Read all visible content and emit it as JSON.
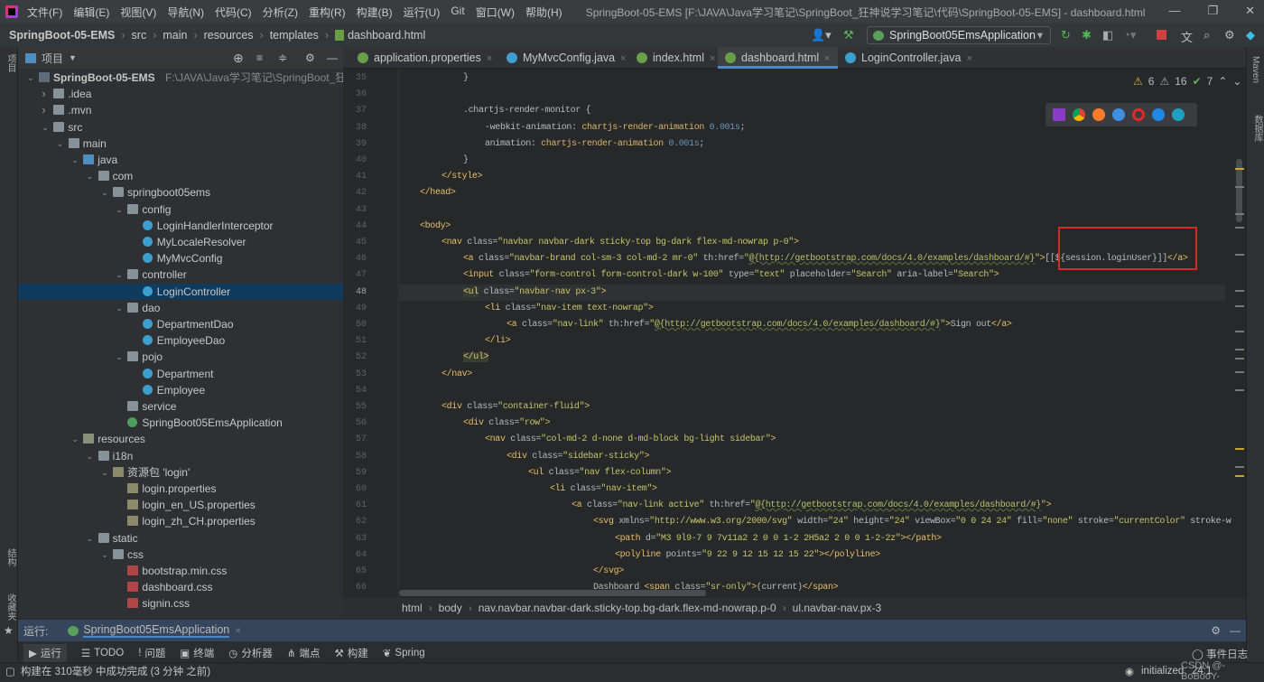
{
  "app": {
    "menu": [
      "文件(F)",
      "编辑(E)",
      "视图(V)",
      "导航(N)",
      "代码(C)",
      "分析(Z)",
      "重构(R)",
      "构建(B)",
      "运行(U)",
      "Git",
      "窗口(W)",
      "帮助(H)"
    ],
    "window_title": "SpringBoot-05-EMS [F:\\JAVA\\Java学习笔记\\SpringBoot_狂神说学习笔记\\代码\\SpringBoot-05-EMS] - dashboard.html",
    "window_buttons": [
      "—",
      "❐",
      "✕"
    ]
  },
  "breadcrumb": [
    "SpringBoot-05-EMS",
    "src",
    "main",
    "resources",
    "templates",
    "dashboard.html"
  ],
  "run_config": "SpringBoot05EmsApplication",
  "project_panel": {
    "title": "项目",
    "side_label": "项目"
  },
  "tree": [
    {
      "d": 0,
      "a": "v",
      "i": "module",
      "t": "SpringBoot-05-EMS",
      "extra": "F:\\JAVA\\Java学习笔记\\SpringBoot_狂神"
    },
    {
      "d": 1,
      "a": ">",
      "i": "folder",
      "t": ".idea"
    },
    {
      "d": 1,
      "a": ">",
      "i": "folder",
      "t": ".mvn"
    },
    {
      "d": 1,
      "a": "v",
      "i": "folder",
      "t": "src"
    },
    {
      "d": 2,
      "a": "v",
      "i": "folder",
      "t": "main"
    },
    {
      "d": 3,
      "a": "v",
      "i": "folder src",
      "t": "java"
    },
    {
      "d": 4,
      "a": "v",
      "i": "folder",
      "t": "com"
    },
    {
      "d": 5,
      "a": "v",
      "i": "folder",
      "t": "springboot05ems"
    },
    {
      "d": 6,
      "a": "v",
      "i": "folder",
      "t": "config"
    },
    {
      "d": 7,
      "a": "",
      "i": "cls",
      "t": "LoginHandlerInterceptor"
    },
    {
      "d": 7,
      "a": "",
      "i": "cls",
      "t": "MyLocaleResolver"
    },
    {
      "d": 7,
      "a": "",
      "i": "cls",
      "t": "MyMvcConfig"
    },
    {
      "d": 6,
      "a": "v",
      "i": "folder",
      "t": "controller"
    },
    {
      "d": 7,
      "a": "",
      "i": "cls",
      "t": "LoginController",
      "sel": true
    },
    {
      "d": 6,
      "a": "v",
      "i": "folder",
      "t": "dao"
    },
    {
      "d": 7,
      "a": "",
      "i": "cls",
      "t": "DepartmentDao"
    },
    {
      "d": 7,
      "a": "",
      "i": "cls",
      "t": "EmployeeDao"
    },
    {
      "d": 6,
      "a": "v",
      "i": "folder",
      "t": "pojo"
    },
    {
      "d": 7,
      "a": "",
      "i": "cls",
      "t": "Department"
    },
    {
      "d": 7,
      "a": "",
      "i": "cls",
      "t": "Employee"
    },
    {
      "d": 6,
      "a": "",
      "i": "folder",
      "t": "service"
    },
    {
      "d": 6,
      "a": "",
      "i": "boot",
      "t": "SpringBoot05EmsApplication"
    },
    {
      "d": 3,
      "a": "v",
      "i": "folder res",
      "t": "resources"
    },
    {
      "d": 4,
      "a": "v",
      "i": "folder",
      "t": "i18n"
    },
    {
      "d": 5,
      "a": "v",
      "i": "prop",
      "t": "资源包 'login'"
    },
    {
      "d": 6,
      "a": "",
      "i": "prop",
      "t": "login.properties"
    },
    {
      "d": 6,
      "a": "",
      "i": "prop",
      "t": "login_en_US.properties"
    },
    {
      "d": 6,
      "a": "",
      "i": "prop",
      "t": "login_zh_CH.properties"
    },
    {
      "d": 4,
      "a": "v",
      "i": "folder",
      "t": "static"
    },
    {
      "d": 5,
      "a": "v",
      "i": "folder",
      "t": "css"
    },
    {
      "d": 6,
      "a": "",
      "i": "css",
      "t": "bootstrap.min.css"
    },
    {
      "d": 6,
      "a": "",
      "i": "css",
      "t": "dashboard.css"
    },
    {
      "d": 6,
      "a": "",
      "i": "css",
      "t": "signin.css"
    }
  ],
  "tabs": [
    {
      "label": "application.properties",
      "color": "#6a9f4a"
    },
    {
      "label": "MyMvcConfig.java",
      "color": "#3d9fcf"
    },
    {
      "label": "index.html",
      "color": "#6a9f4a"
    },
    {
      "label": "dashboard.html",
      "color": "#6a9f4a",
      "active": true
    },
    {
      "label": "LoginController.java",
      "color": "#3d9fcf"
    }
  ],
  "inspections": {
    "warnings": "6",
    "weak_warnings": "16",
    "ok": "7"
  },
  "code_lines": [
    {
      "n": "35",
      "ind": 2,
      "s": [
        [
          "pl",
          "}"
        ]
      ]
    },
    {
      "n": "36",
      "ind": 0,
      "s": []
    },
    {
      "n": "37",
      "ind": 2,
      "s": [
        [
          "pl",
          ".chartjs-render-monitor {"
        ]
      ]
    },
    {
      "n": "38",
      "ind": 3,
      "s": [
        [
          "cp",
          "-webkit-animation: "
        ],
        [
          "cv",
          "chartjs-render-animation "
        ],
        [
          "nm",
          "0.001s"
        ],
        [
          "pl",
          ";"
        ]
      ]
    },
    {
      "n": "39",
      "ind": 3,
      "s": [
        [
          "cp",
          "animation: "
        ],
        [
          "cv",
          "chartjs-render-animation "
        ],
        [
          "nm",
          "0.001s"
        ],
        [
          "pl",
          ";"
        ]
      ]
    },
    {
      "n": "40",
      "ind": 2,
      "s": [
        [
          "pl",
          "}"
        ]
      ]
    },
    {
      "n": "41",
      "ind": 1,
      "s": [
        [
          "tg",
          "</style>"
        ]
      ]
    },
    {
      "n": "42",
      "ind": 0,
      "s": [
        [
          "tg",
          "</head>"
        ]
      ]
    },
    {
      "n": "43",
      "ind": 0,
      "s": []
    },
    {
      "n": "44",
      "ind": 0,
      "s": [
        [
          "tg",
          "<body>"
        ]
      ]
    },
    {
      "n": "45",
      "ind": 1,
      "s": [
        [
          "tg",
          "<nav "
        ],
        [
          "at",
          "class="
        ],
        [
          "vl",
          "\"navbar navbar-dark sticky-top bg-dark flex-md-nowrap p-0\""
        ],
        [
          "tg",
          ">"
        ]
      ]
    },
    {
      "n": "46",
      "ind": 2,
      "s": [
        [
          "tg",
          "<a "
        ],
        [
          "at",
          "class="
        ],
        [
          "vl",
          "\"navbar-brand col-sm-3 col-md-2 mr-0\" "
        ],
        [
          "at",
          "th:href="
        ],
        [
          "vl",
          "\""
        ],
        [
          "ur",
          "@{http://getbootstrap.com/docs/4.0/examples/dashboard/#}"
        ],
        [
          "vl",
          "\""
        ],
        [
          "tg",
          ">"
        ],
        [
          "pl",
          "[[${session.loginUser}]]"
        ],
        [
          "tg",
          "</a>"
        ]
      ]
    },
    {
      "n": "47",
      "ind": 2,
      "s": [
        [
          "tg",
          "<input "
        ],
        [
          "at",
          "class="
        ],
        [
          "vl",
          "\"form-control form-control-dark w-100\" "
        ],
        [
          "at",
          "type="
        ],
        [
          "vl",
          "\"text\" "
        ],
        [
          "at",
          "placeholder="
        ],
        [
          "vl",
          "\"Search\" "
        ],
        [
          "at",
          "aria-label="
        ],
        [
          "vl",
          "\"Search\""
        ],
        [
          "tg",
          ">"
        ]
      ]
    },
    {
      "n": "48",
      "ind": 2,
      "cur": true,
      "s": [
        [
          "tg hl",
          "<ul"
        ],
        [
          "at",
          " class="
        ],
        [
          "vl",
          "\"navbar-nav px-3\""
        ],
        [
          "tg",
          ">"
        ]
      ]
    },
    {
      "n": "49",
      "ind": 3,
      "s": [
        [
          "tg",
          "<li "
        ],
        [
          "at",
          "class="
        ],
        [
          "vl",
          "\"nav-item text-nowrap\""
        ],
        [
          "tg",
          ">"
        ]
      ]
    },
    {
      "n": "50",
      "ind": 4,
      "s": [
        [
          "tg",
          "<a "
        ],
        [
          "at",
          "class="
        ],
        [
          "vl",
          "\"nav-link\" "
        ],
        [
          "at",
          "th:href="
        ],
        [
          "vl",
          "\""
        ],
        [
          "ur",
          "@{http://getbootstrap.com/docs/4.0/examples/dashboard/#}"
        ],
        [
          "vl",
          "\""
        ],
        [
          "tg",
          ">"
        ],
        [
          "pl",
          "Sign out"
        ],
        [
          "tg",
          "</a>"
        ]
      ]
    },
    {
      "n": "51",
      "ind": 3,
      "s": [
        [
          "tg",
          "</li>"
        ]
      ]
    },
    {
      "n": "52",
      "ind": 2,
      "s": [
        [
          "tg hl",
          "</ul>"
        ]
      ]
    },
    {
      "n": "53",
      "ind": 1,
      "s": [
        [
          "tg",
          "</nav>"
        ]
      ]
    },
    {
      "n": "54",
      "ind": 0,
      "s": []
    },
    {
      "n": "55",
      "ind": 1,
      "s": [
        [
          "tg",
          "<div "
        ],
        [
          "at",
          "class="
        ],
        [
          "vl",
          "\"container-fluid\""
        ],
        [
          "tg",
          ">"
        ]
      ]
    },
    {
      "n": "56",
      "ind": 2,
      "s": [
        [
          "tg",
          "<div "
        ],
        [
          "at",
          "class="
        ],
        [
          "vl",
          "\"row\""
        ],
        [
          "tg",
          ">"
        ]
      ]
    },
    {
      "n": "57",
      "ind": 3,
      "s": [
        [
          "tg",
          "<nav "
        ],
        [
          "at",
          "class="
        ],
        [
          "vl",
          "\"col-md-2 d-none d-md-block bg-light sidebar\""
        ],
        [
          "tg",
          ">"
        ]
      ]
    },
    {
      "n": "58",
      "ind": 4,
      "s": [
        [
          "tg",
          "<div "
        ],
        [
          "at",
          "class="
        ],
        [
          "vl",
          "\"sidebar-sticky\""
        ],
        [
          "tg",
          ">"
        ]
      ]
    },
    {
      "n": "59",
      "ind": 5,
      "s": [
        [
          "tg",
          "<ul "
        ],
        [
          "at",
          "class="
        ],
        [
          "vl",
          "\"nav flex-column\""
        ],
        [
          "tg",
          ">"
        ]
      ]
    },
    {
      "n": "60",
      "ind": 6,
      "s": [
        [
          "tg",
          "<li "
        ],
        [
          "at",
          "class="
        ],
        [
          "vl",
          "\"nav-item\""
        ],
        [
          "tg",
          ">"
        ]
      ]
    },
    {
      "n": "61",
      "ind": 7,
      "s": [
        [
          "tg",
          "<a "
        ],
        [
          "at",
          "class="
        ],
        [
          "vl",
          "\"nav-link active\" "
        ],
        [
          "at",
          "th:href="
        ],
        [
          "vl",
          "\""
        ],
        [
          "ur",
          "@{http://getbootstrap.com/docs/4.0/examples/dashboard/#}"
        ],
        [
          "vl",
          "\""
        ],
        [
          "tg",
          ">"
        ]
      ]
    },
    {
      "n": "62",
      "ind": 8,
      "s": [
        [
          "tg",
          "<svg "
        ],
        [
          "at",
          "xmlns="
        ],
        [
          "vl",
          "\"http://www.w3.org/2000/svg\" "
        ],
        [
          "at",
          "width="
        ],
        [
          "vl",
          "\"24\" "
        ],
        [
          "at",
          "height="
        ],
        [
          "vl",
          "\"24\" "
        ],
        [
          "at",
          "viewBox="
        ],
        [
          "vl",
          "\"0 0 24 24\" "
        ],
        [
          "at",
          "fill="
        ],
        [
          "vl",
          "\"none\" "
        ],
        [
          "at",
          "stroke="
        ],
        [
          "vl",
          "\"currentColor\" "
        ],
        [
          "at",
          "stroke-w"
        ]
      ]
    },
    {
      "n": "63",
      "ind": 9,
      "s": [
        [
          "tg",
          "<path "
        ],
        [
          "at",
          "d="
        ],
        [
          "vl",
          "\"M3 9l9-7 9 7v11a2 2 0 0 1-2 2H5a2 2 0 0 1-2-2z\""
        ],
        [
          "tg",
          "></path>"
        ]
      ]
    },
    {
      "n": "64",
      "ind": 9,
      "s": [
        [
          "tg",
          "<polyline "
        ],
        [
          "at",
          "points="
        ],
        [
          "vl",
          "\"9 22 9 12 15 12 15 22\""
        ],
        [
          "tg",
          "></polyline>"
        ]
      ]
    },
    {
      "n": "65",
      "ind": 8,
      "s": [
        [
          "tg",
          "</svg>"
        ]
      ]
    },
    {
      "n": "66",
      "ind": 8,
      "s": [
        [
          "pl",
          "Dashboard "
        ],
        [
          "tg",
          "<span "
        ],
        [
          "at",
          "class="
        ],
        [
          "vl",
          "\"sr-only\""
        ],
        [
          "tg",
          ">"
        ],
        [
          "pl",
          "(current)"
        ],
        [
          "tg",
          "</span>"
        ]
      ]
    }
  ],
  "editor_breadcrumb": [
    "html",
    "body",
    "nav.navbar.navbar-dark.sticky-top.bg-dark.flex-md-nowrap.p-0",
    "ul.navbar-nav.px-3"
  ],
  "run_panel": {
    "label": "运行:",
    "tab": "SpringBoot05EmsApplication"
  },
  "tool_windows": [
    "运行",
    "TODO",
    "问题",
    "终端",
    "分析器",
    "端点",
    "构建",
    "Spring"
  ],
  "event_log": "事件日志",
  "status": {
    "message": "构建在 310毫秒 中成功完成 (3 分钟 之前)",
    "right": "initialized",
    "position": "24:1",
    "watermark": "CSDN @-BoBooY-"
  },
  "right_strip": [
    "Maven",
    "数据库"
  ],
  "left_strip_bottom": [
    "结构",
    "收藏夹"
  ]
}
